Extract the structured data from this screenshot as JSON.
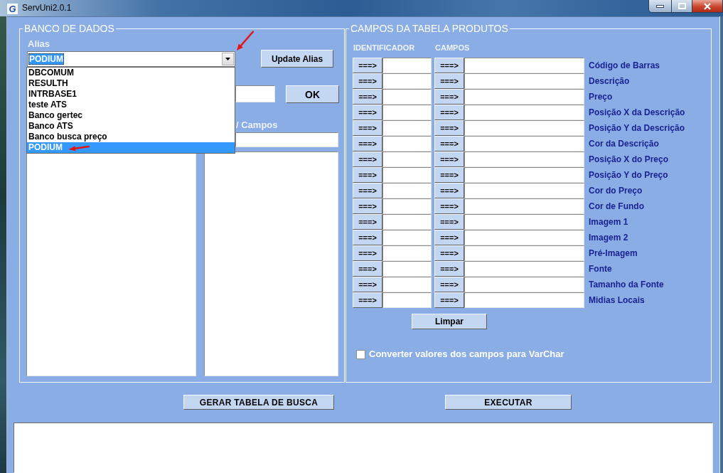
{
  "window": {
    "logo_text": "G",
    "title": "ServUni2.0.1"
  },
  "database_group": {
    "title": "BANCO DE DADOS",
    "alias": {
      "label": "Alias",
      "value": "PODIUM",
      "focused": true,
      "expanded": true,
      "options": [
        {
          "label": "DBCOMUM",
          "selected": false
        },
        {
          "label": "RESULTH",
          "selected": false
        },
        {
          "label": "INTRBASE1",
          "selected": false
        },
        {
          "label": "teste ATS",
          "selected": false
        },
        {
          "label": "Banco gertec",
          "selected": false
        },
        {
          "label": "Banco ATS",
          "selected": false
        },
        {
          "label": "Banco busca preço",
          "selected": false
        },
        {
          "label": "PODIUM",
          "selected": true
        }
      ]
    },
    "update_button": "Update Alias",
    "ok_button": "OK",
    "fields_label": "/ Campos"
  },
  "products_group": {
    "title": "CAMPOS DA TABELA PRODUTOS",
    "columns": [
      "IDENTIFICADOR",
      "CAMPOS"
    ],
    "rows": [
      {
        "identifier_button": "===>",
        "field_button": "===>",
        "label": "Código de Barras"
      },
      {
        "identifier_button": "===>",
        "field_button": "===>",
        "label": "Descrição"
      },
      {
        "identifier_button": "===>",
        "field_button": "===>",
        "label": "Preço"
      },
      {
        "identifier_button": "===>",
        "field_button": "===>",
        "label": "Posição X da Descrição"
      },
      {
        "identifier_button": "===>",
        "field_button": "===>",
        "label": "Posição Y da Descrição"
      },
      {
        "identifier_button": "===>",
        "field_button": "===>",
        "label": "Cor da Descrição"
      },
      {
        "identifier_button": "===>",
        "field_button": "===>",
        "label": "Posição X do Preço"
      },
      {
        "identifier_button": "===>",
        "field_button": "===>",
        "label": "Posição Y do Preço"
      },
      {
        "identifier_button": "===>",
        "field_button": "===>",
        "label": "Cor do Preço"
      },
      {
        "identifier_button": "===>",
        "field_button": "===>",
        "label": "Cor de Fundo"
      },
      {
        "identifier_button": "===>",
        "field_button": "===>",
        "label": "Imagem 1"
      },
      {
        "identifier_button": "===>",
        "field_button": "===>",
        "label": "Imagem 2"
      },
      {
        "identifier_button": "===>",
        "field_button": "===>",
        "label": "Pré-Imagem"
      },
      {
        "identifier_button": "===>",
        "field_button": "===>",
        "label": "Fonte"
      },
      {
        "identifier_button": "===>",
        "field_button": "===>",
        "label": "Tamanho da Fonte"
      },
      {
        "identifier_button": "===>",
        "field_button": "===>",
        "label": "Midias Locais"
      }
    ],
    "clear_button": "Limpar",
    "varchar_option": {
      "label": "Converter valores dos campos para VarChar",
      "checked": false
    }
  },
  "actions": [
    "GERAR TABELA DE BUSCA",
    "EXECUTAR"
  ]
}
